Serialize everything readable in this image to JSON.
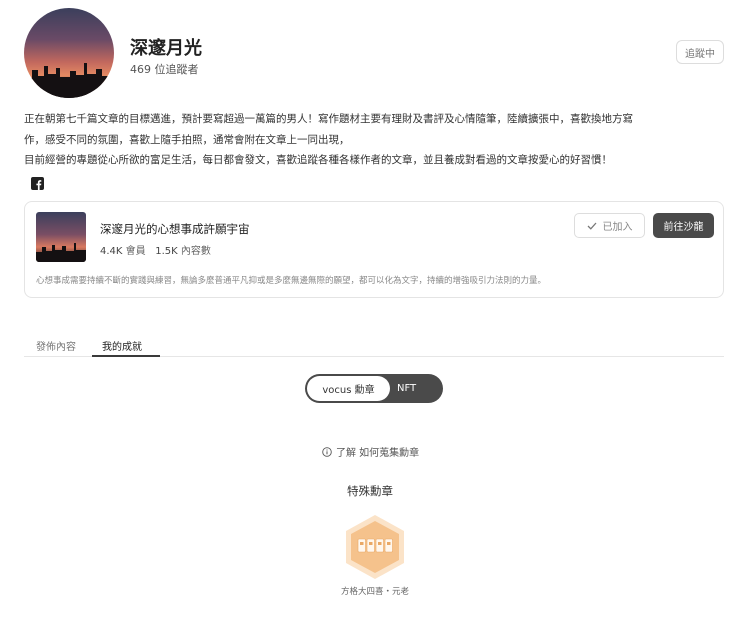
{
  "profile": {
    "name": "深邃月光",
    "followers": "469 位追蹤者",
    "follow_label": "追蹤中"
  },
  "bio": {
    "line1": "正在朝第七千篇文章的目標邁進，預計要寫超過一萬篇的男人！寫作題材主要有理財及書評及心情隨筆，陸續擴張中，喜歡換地方寫",
    "line2": "作，感受不同的氛圍，喜歡上隨手拍照，通常會附在文章上一同出現，",
    "line3": "目前經營的專題從心所欲的富足生活，每日都會發文，喜歡追蹤各種各樣作者的文章，並且養成對看過的文章按愛心的好習慣！"
  },
  "social": {
    "icon": "facebook-icon"
  },
  "club": {
    "title": "深邃月光的心想事成許願宇宙",
    "members_value": "4.4K",
    "members_label": "會員",
    "content_value": "1.5K",
    "content_label": "內容數",
    "joined_label": "已加入",
    "go_label": "前往沙龍",
    "description": "心想事成需要持續不斷的實踐與練習，無論多麼普通平凡抑或是多麼無邊無際的願望，都可以化為文字，持續的增強吸引力法則的力量。"
  },
  "tabs": [
    {
      "label": "發佈內容",
      "active": false
    },
    {
      "label": "我的成就",
      "active": true
    }
  ],
  "toggle": {
    "option1": "vocus 勳章",
    "option2": "NFT",
    "selected": "vocus 勳章"
  },
  "achievements": {
    "learn_link": "了解 如何蒐集勳章",
    "section_title": "特殊勳章",
    "badge_caption": "方格大四喜・元老"
  },
  "colors": {
    "accent_dark": "#4a4a4a",
    "badge_orange": "#f5c28c"
  }
}
